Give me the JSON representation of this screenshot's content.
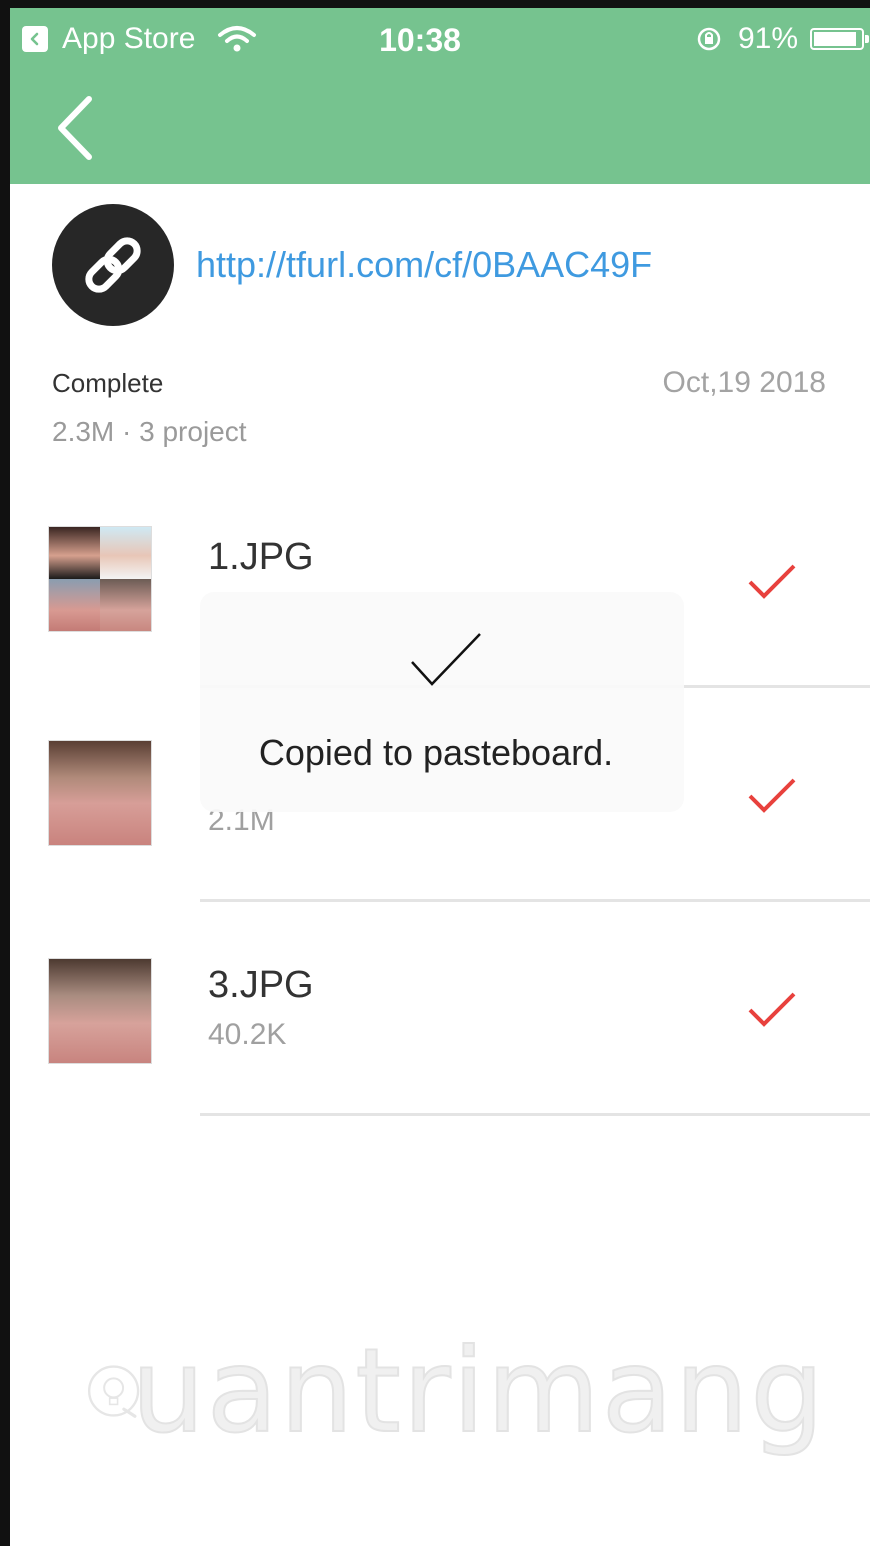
{
  "status_bar": {
    "back_app": "App Store",
    "time": "10:38",
    "battery": "91%",
    "battery_level": 0.91
  },
  "link": {
    "url": "http://tfurl.com/cf/0BAAC49F"
  },
  "transfer": {
    "status": "Complete",
    "summary": "2.3M · 3 project",
    "date": "Oct,19 2018"
  },
  "files": [
    {
      "name": "1.JPG",
      "size": "",
      "checked": true
    },
    {
      "name": "",
      "size": "2.1M",
      "checked": true
    },
    {
      "name": "3.JPG",
      "size": "40.2K",
      "checked": true
    }
  ],
  "toast": {
    "message": "Copied to pasteboard."
  },
  "watermark": {
    "text": "uantrimang"
  },
  "colors": {
    "app_bar": "#76c38f",
    "link": "#3f9ae0",
    "check": "#e8413d"
  }
}
